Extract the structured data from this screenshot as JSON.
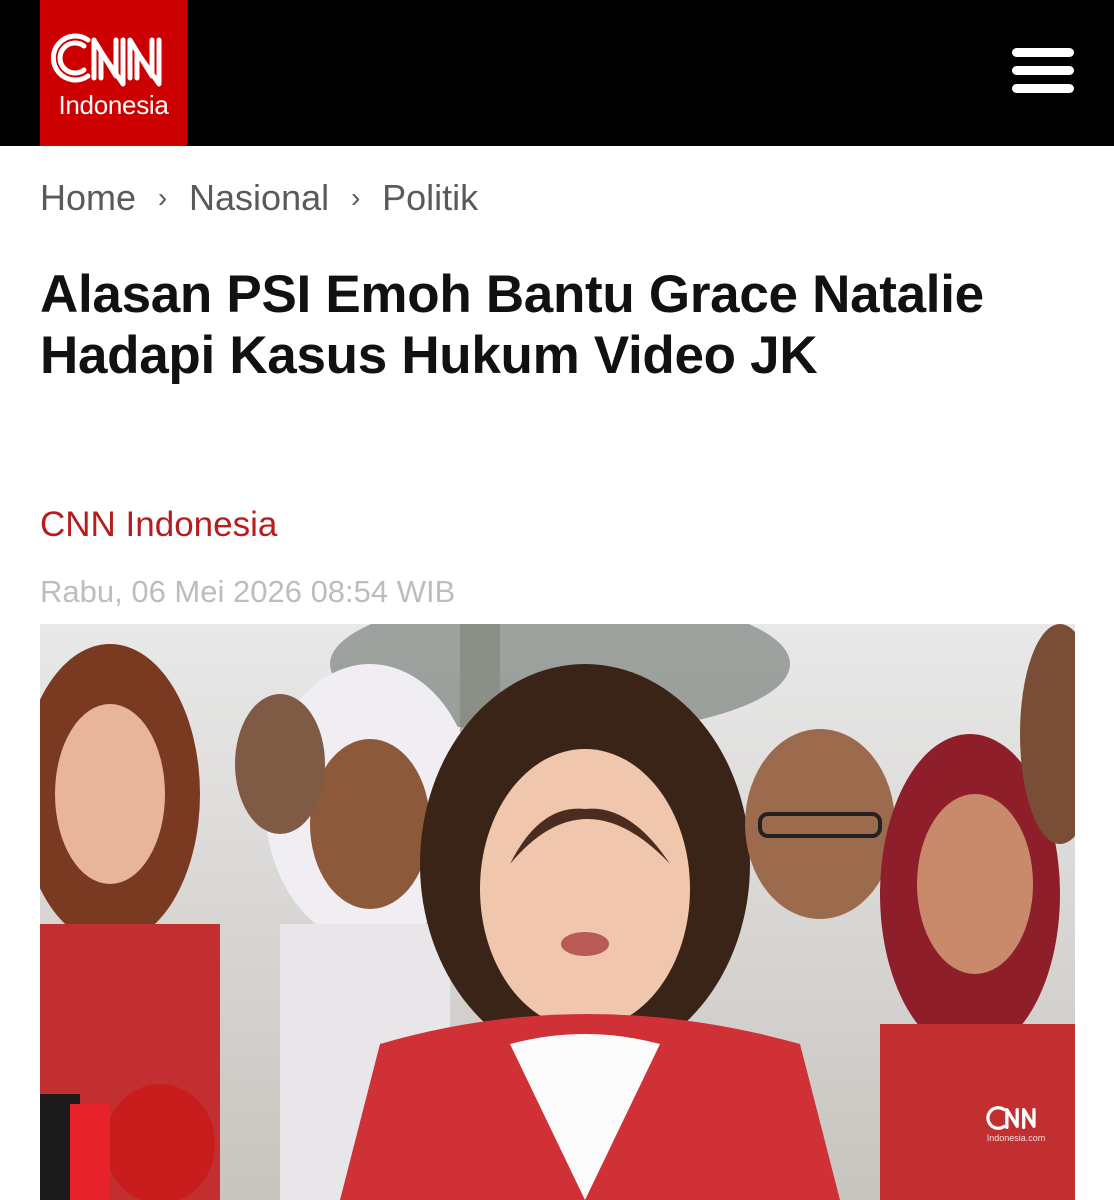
{
  "header": {
    "logo_text": "CNN",
    "logo_subtitle": "Indonesia",
    "menu_icon": "hamburger-menu-icon"
  },
  "breadcrumb": {
    "items": [
      "Home",
      "Nasional",
      "Politik"
    ],
    "separator": "›"
  },
  "article": {
    "title": "Alasan PSI Emoh Bantu Grace Natalie Hadapi Kasus Hukum Video JK",
    "author": "CNN Indonesia",
    "date": "Rabu, 06 Mei 2026 08:54 WIB"
  },
  "image": {
    "watermark_text": "CNN",
    "watermark_subtitle": "Indonesia.com"
  },
  "colors": {
    "brand_red": "#cc0000",
    "header_bg": "#000000",
    "author_red": "#b81d1d",
    "date_gray": "#bdbdbd"
  }
}
